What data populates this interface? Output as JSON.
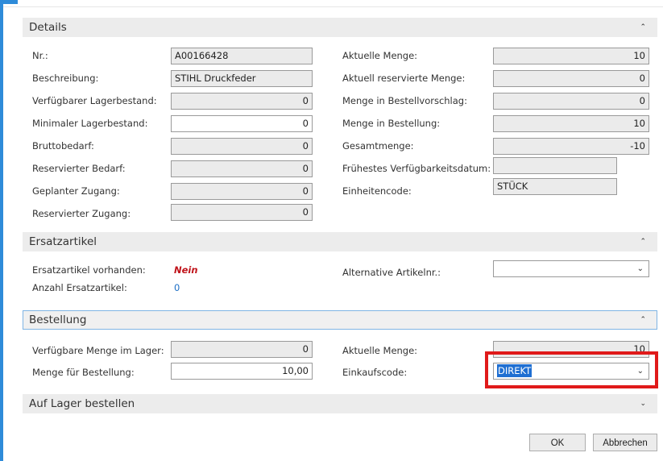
{
  "sections": {
    "details": {
      "title": "Details"
    },
    "ersatz": {
      "title": "Ersatzartikel"
    },
    "bestellung": {
      "title": "Bestellung"
    },
    "auflager": {
      "title": "Auf Lager bestellen"
    }
  },
  "icons": {
    "collapse": "⌃",
    "expand": "⌄",
    "dropdown": "⌄"
  },
  "details": {
    "left": [
      {
        "label": "Nr.:",
        "value": "A00166428"
      },
      {
        "label": "Beschreibung:",
        "value": "STIHL Druckfeder"
      },
      {
        "label": "Verfügbarer Lagerbestand:",
        "value": "0"
      },
      {
        "label": "Minimaler Lagerbestand:",
        "value": "0"
      },
      {
        "label": "Bruttobedarf:",
        "value": "0"
      },
      {
        "label": "Reservierter Bedarf:",
        "value": "0"
      },
      {
        "label": "Geplanter Zugang:",
        "value": "0"
      },
      {
        "label": "Reservierter Zugang:",
        "value": "0"
      }
    ],
    "right": [
      {
        "label": "Aktuelle Menge:",
        "value": "10"
      },
      {
        "label": "Aktuell reservierte Menge:",
        "value": "0"
      },
      {
        "label": "Menge in Bestellvorschlag:",
        "value": "0"
      },
      {
        "label": "Menge in Bestellung:",
        "value": "10"
      },
      {
        "label": "Gesamtmenge:",
        "value": "-10"
      },
      {
        "label": "Frühestes Verfügbarkeitsdatum:",
        "value": ""
      },
      {
        "label": "Einheitencode:",
        "value": "STÜCK"
      }
    ]
  },
  "ersatz": {
    "vorhanden_label": "Ersatzartikel vorhanden:",
    "vorhanden_value": "Nein",
    "anzahl_label": "Anzahl Ersatzartikel:",
    "anzahl_value": "0",
    "alt_label": "Alternative Artikelnr.:",
    "alt_value": ""
  },
  "bestellung": {
    "verf_label": "Verfügbare Menge im Lager:",
    "verf_value": "0",
    "menge_label": "Menge für Bestellung:",
    "menge_value": "10,00",
    "akt_label": "Aktuelle Menge:",
    "akt_value": "10",
    "einkauf_label": "Einkaufscode:",
    "einkauf_value": "DIREKT"
  },
  "buttons": {
    "ok": "OK",
    "cancel": "Abbrechen"
  },
  "colors": {
    "accent": "#2e8bd9",
    "highlight": "#e01a1a",
    "negative": "#c0141b",
    "link": "#1d6fc6"
  }
}
